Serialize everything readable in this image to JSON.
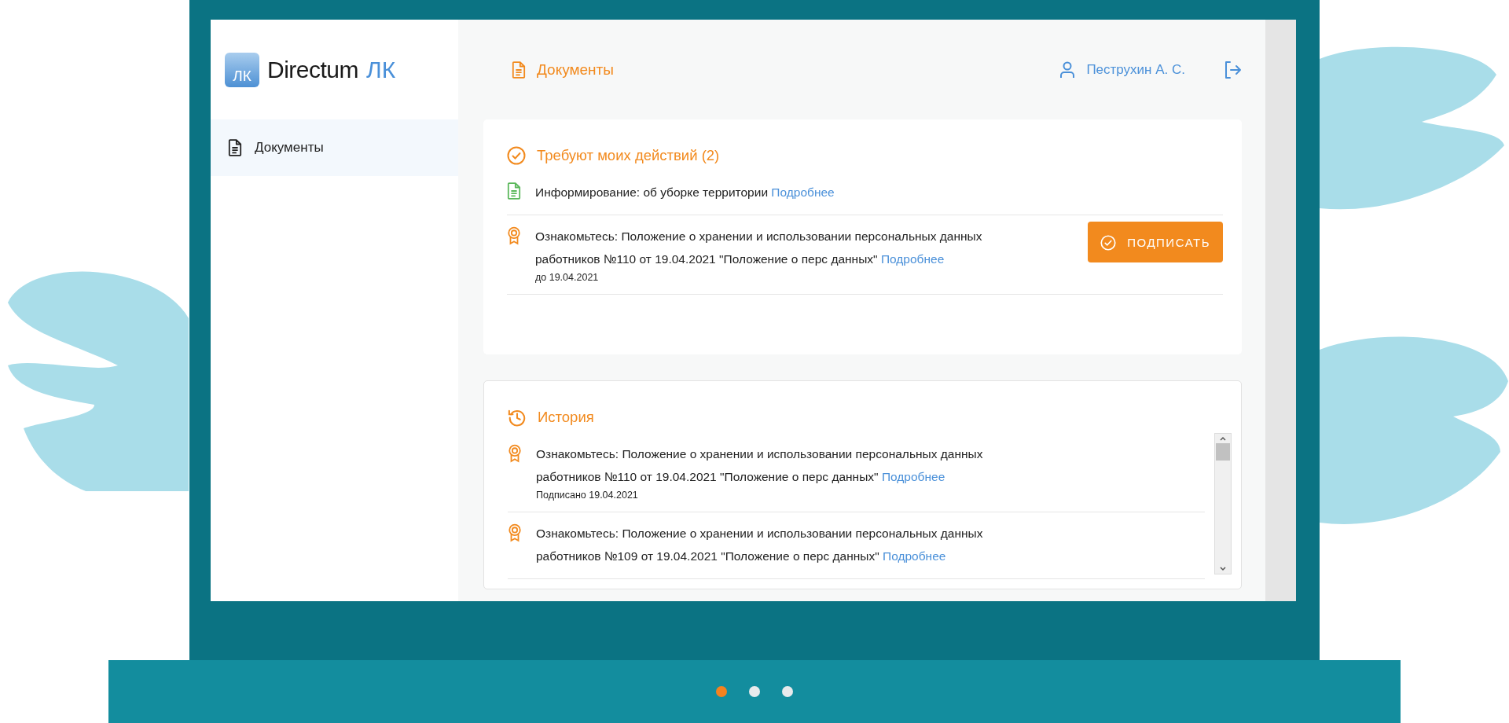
{
  "app": {
    "logo": {
      "name": "Directum",
      "suffix": "ЛК",
      "badge": "ЛК"
    },
    "sidebar": {
      "items": [
        {
          "label": "Документы",
          "selected": true
        }
      ]
    },
    "header": {
      "title": "Документы",
      "user": "Пеструхин А. С."
    },
    "sections": [
      {
        "kind": "actions",
        "title": "Требуют моих действий (2)",
        "items": [
          {
            "kind": "info",
            "text": "Информирование: об уборке территории",
            "link": "Подробнее"
          },
          {
            "kind": "acknowledge",
            "text": "Ознакомьтесь: Положение о хранении и использовании персональных данных работников №110 от 19.04.2021 \"Положение о перс данных\"",
            "link": "Подробнее",
            "note": "до 19.04.2021",
            "button": "ПОДПИСАТЬ"
          }
        ]
      },
      {
        "kind": "history",
        "title": "История",
        "items": [
          {
            "kind": "acknowledge",
            "text": "Ознакомьтесь: Положение о хранении и использовании персональных данных работников №110 от 19.04.2021 \"Положение о перс данных\"",
            "link": "Подробнее",
            "note": "Подписано 19.04.2021"
          },
          {
            "kind": "acknowledge",
            "text": "Ознакомьтесь: Положение о хранении и использовании персональных данных работников №109 от 19.04.2021 \"Положение о перс данных\"",
            "link": "Подробнее"
          }
        ]
      }
    ]
  },
  "carousel": {
    "dots": [
      {
        "selected": true
      },
      {
        "selected": false
      },
      {
        "selected": false
      }
    ]
  }
}
